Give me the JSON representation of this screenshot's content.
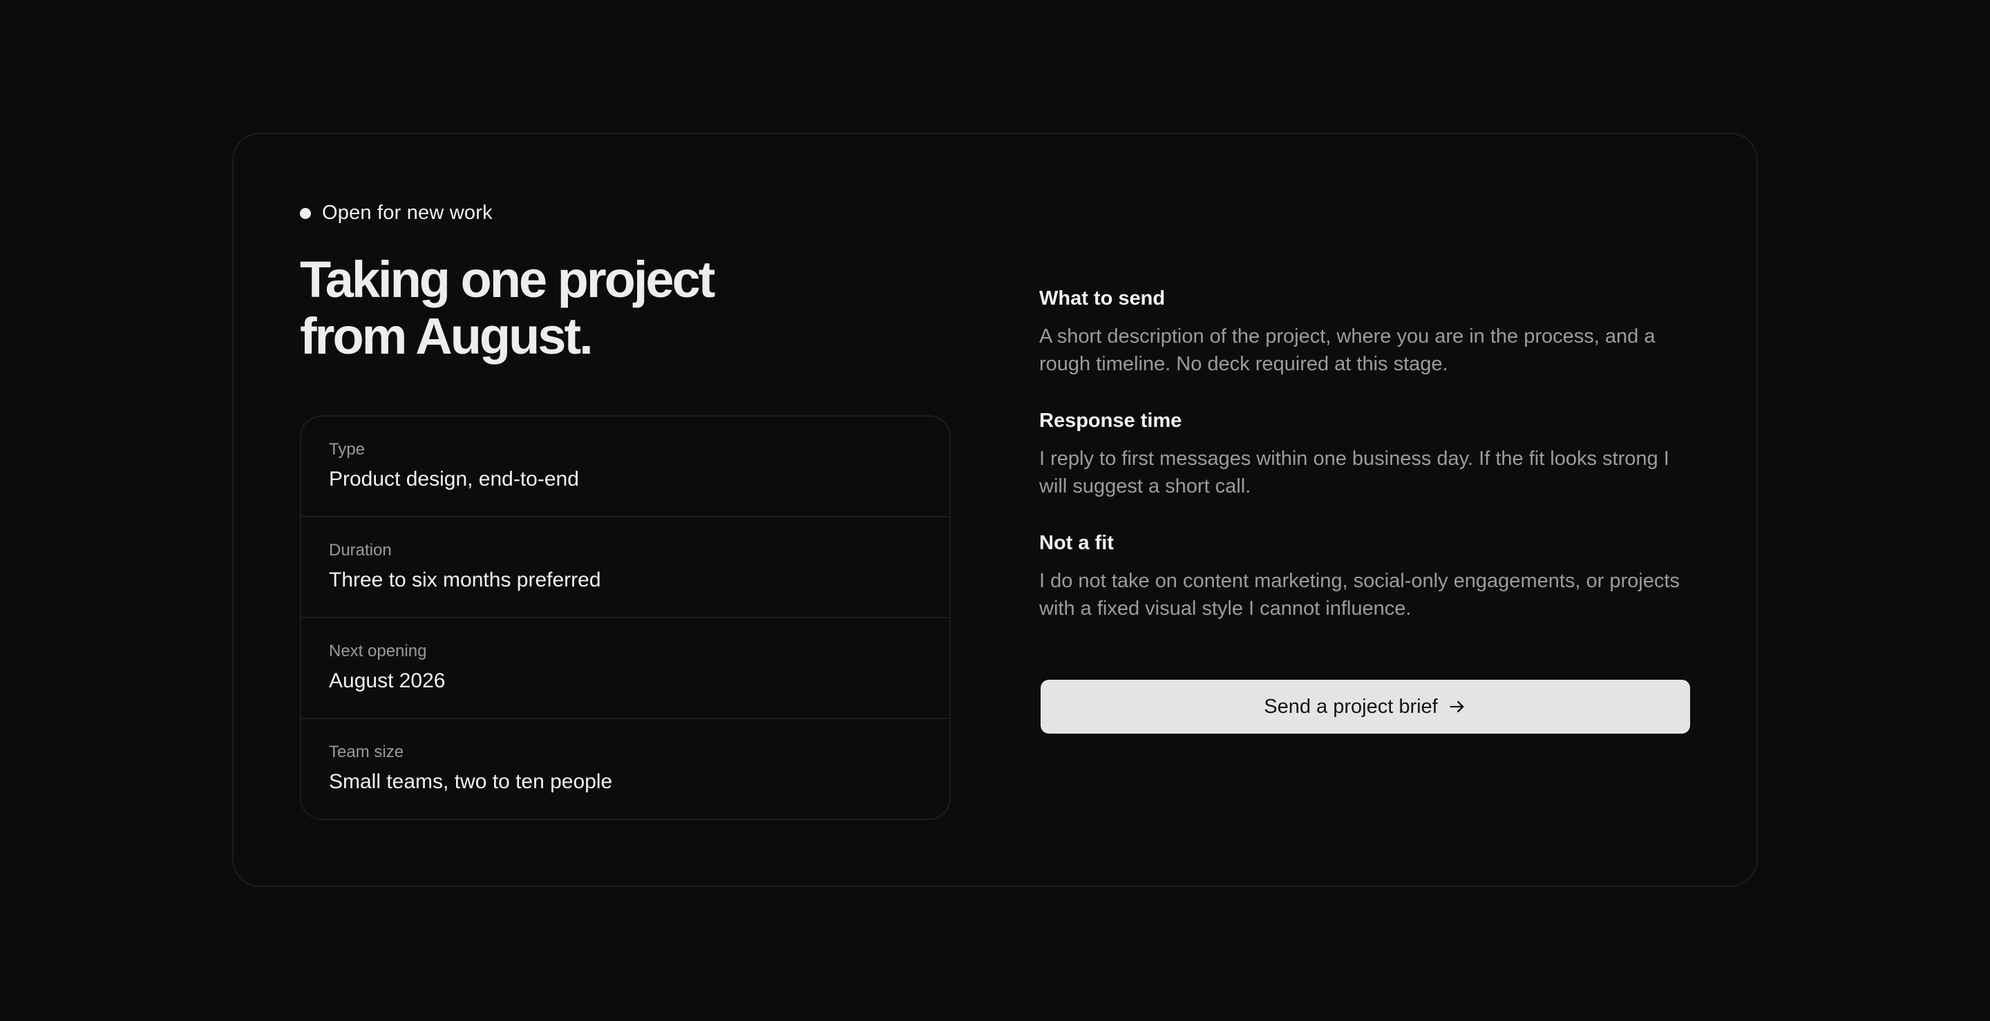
{
  "status": {
    "text": "Open for new work"
  },
  "headline": {
    "line1": "Taking one project",
    "line2": "from August."
  },
  "details": [
    {
      "label": "Type",
      "value": "Product design, end-to-end"
    },
    {
      "label": "Duration",
      "value": "Three to six months preferred"
    },
    {
      "label": "Next opening",
      "value": "August 2026"
    },
    {
      "label": "Team size",
      "value": "Small teams, two to ten people"
    }
  ],
  "info": [
    {
      "heading": "What to send",
      "body": "A short description of the project, where you are in the process, and a rough timeline. No deck required at this stage."
    },
    {
      "heading": "Response time",
      "body": "I reply to first messages within one business day. If the fit looks strong I will suggest a short call."
    },
    {
      "heading": "Not a fit",
      "body": "I do not take on content marketing, social-only engagements, or projects with a fixed visual style I cannot influence."
    }
  ],
  "cta": {
    "label": "Send a project brief",
    "icon": "arrow-right-icon"
  },
  "colors": {
    "background": "#0b0b0b",
    "card": "#0c0c0c",
    "border": "#1d1d1d",
    "text_primary": "#ededed",
    "text_muted": "#9c9c9c",
    "button_bg": "#e4e4e4"
  }
}
